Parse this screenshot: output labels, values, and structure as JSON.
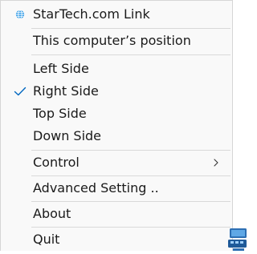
{
  "menu": {
    "items": [
      {
        "label": "StarTech.com Link",
        "icon": "globe-icon"
      },
      {
        "label": "This computer’s position"
      },
      {
        "label": "Left Side"
      },
      {
        "label": "Right Side",
        "checked": true
      },
      {
        "label": "Top Side"
      },
      {
        "label": "Down Side"
      },
      {
        "label": "Control",
        "submenu": true
      },
      {
        "label": "Advanced Setting .."
      },
      {
        "label": "About"
      },
      {
        "label": "Quit"
      }
    ]
  },
  "colors": {
    "menu_background": "#f9f9f9",
    "separator": "#d9d9d9",
    "check_accent": "#0067c0",
    "globe": "#3aa0e8",
    "taskbar_icon": "#2d6fb3"
  }
}
